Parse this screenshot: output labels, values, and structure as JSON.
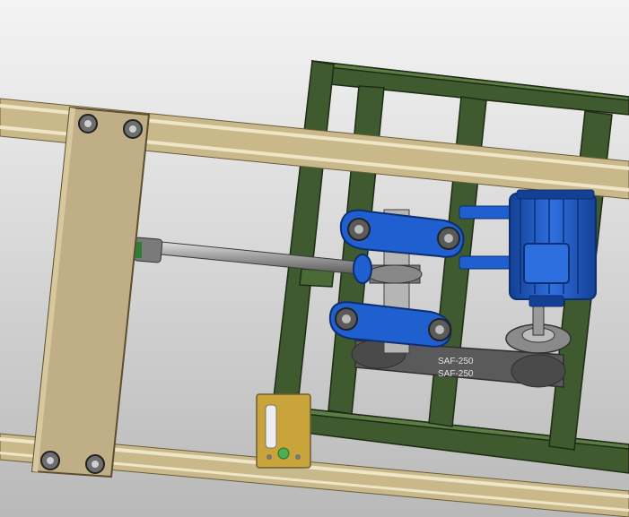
{
  "scene": {
    "belt_marking_top": "SAF-250",
    "belt_marking_bottom": "SAF-250"
  },
  "colors": {
    "background_top": "#f2f2f2",
    "background_bottom": "#bdbdbd",
    "rail": "#c9b98a",
    "rail_highlight": "#efe6c8",
    "rail_dark": "#8a7a52",
    "plate": "#bfae86",
    "frame_green": "#3f5a2e",
    "frame_green_light": "#5e7d45",
    "motor_blue": "#1f5fd0",
    "motor_blue_dark": "#133f94",
    "rod_grey": "#9a9a9a",
    "belt_grey": "#555555",
    "bolt_grey": "#6e6e6e",
    "bracket_yellow": "#c9a43a"
  }
}
